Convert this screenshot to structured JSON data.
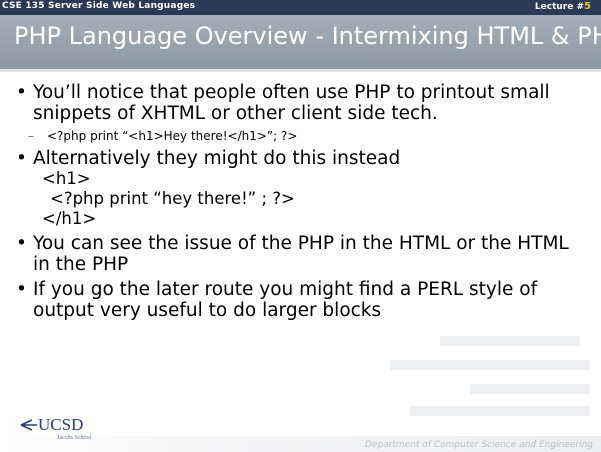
{
  "header": {
    "course": "CSE 135   Server Side Web Languages",
    "lecture_label": "Lecture #",
    "lecture_number": "5"
  },
  "title": "PHP Language Overview - Intermixing HTML & PHP",
  "bullets": [
    {
      "text": "You’ll notice that people often use PHP to printout small snippets of XHTML or other client side tech."
    },
    {
      "text": "Alternatively they might do this instead"
    },
    {
      "text": "You can see the issue of the PHP in the HTML or the HTML in the PHP"
    },
    {
      "text": "If you go the later route you might find a PERL style of output very useful to do larger blocks"
    }
  ],
  "sub_bullet": {
    "dash": "–",
    "text": "<?php print “<h1>Hey there!</h1>”; ?>"
  },
  "code_block": [
    "<h1>",
    "<?php print “hey there!” ; ?>",
    "</h1>"
  ],
  "logo": {
    "text": "UCSD",
    "subtext": "Jacobs School"
  },
  "footer": "Department of Computer Science and Engineering",
  "colors": {
    "header_bar": "#2a3a54",
    "title_band": "#98a5b2",
    "lecture_number": "#f1c232",
    "logo": "#27406d"
  }
}
